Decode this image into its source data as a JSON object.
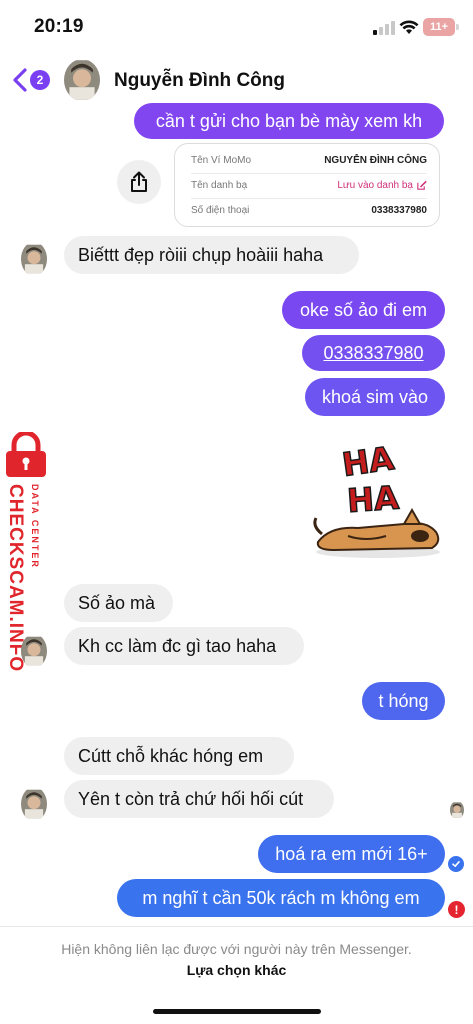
{
  "status_bar": {
    "time": "20:19",
    "battery": "11+"
  },
  "header": {
    "back_count": "2",
    "contact_name": "Nguyễn Đình Công",
    "accent": "#7b3ff2"
  },
  "card": {
    "rows": [
      {
        "label": "Tên Ví MoMo",
        "value": "NGUYỄN ĐÌNH CÔNG"
      },
      {
        "label": "Tên danh bạ",
        "value": "Lưu vào danh bạ"
      },
      {
        "label": "Số điện thoại",
        "value": "0338337980"
      }
    ]
  },
  "messages": [
    {
      "side": "out",
      "text": "cần t gửi cho bạn bè mày xem kh"
    },
    {
      "side": "in",
      "text": "Biếttt đẹp ròiii chụp hoàiii haha"
    },
    {
      "side": "out",
      "text": "oke số ảo đi em"
    },
    {
      "side": "out",
      "text": "0338337980"
    },
    {
      "side": "out",
      "text": "khoá sim vào"
    },
    {
      "side": "in",
      "text": "Số ảo mà"
    },
    {
      "side": "in",
      "text": "Kh cc làm đc gì tao haha"
    },
    {
      "side": "out",
      "text": "t hóng"
    },
    {
      "side": "in",
      "text": "Cútt chỗ khác hóng em"
    },
    {
      "side": "in",
      "text": "Yên t còn trả chứ hối hối cút"
    },
    {
      "side": "out",
      "text": "hoá ra em mới 16+"
    },
    {
      "side": "out",
      "text": "m nghĩ t cần 50k rách m không em"
    }
  ],
  "sticker": {
    "text_top": "HA",
    "text_bottom": "HA"
  },
  "watermark": {
    "main": "CHECKSCAM.INFO",
    "sub": "DATA CENTER"
  },
  "footer": {
    "notice": "Hiện không liên lạc được với người này trên Messenger.",
    "action": "Lựa chọn khác"
  },
  "colors": {
    "bubble_in": "#efefef",
    "outgoing_top": "#8246f0",
    "outgoing_bottom": "#3a73ee",
    "error": "#e4252f",
    "brand_red": "#e0262c"
  }
}
